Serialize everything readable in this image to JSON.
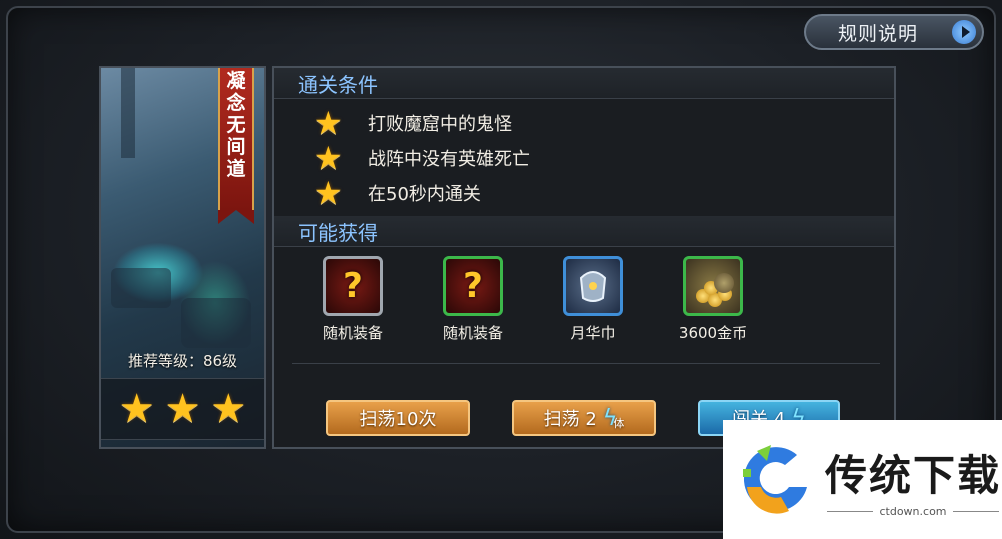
{
  "rules_button": {
    "label": "规则说明",
    "icon": "play-arrow-icon"
  },
  "level": {
    "name_chars": [
      "凝",
      "念",
      "无",
      "间",
      "道"
    ],
    "recommended_level": "推荐等级：86级",
    "stars_earned": 3
  },
  "conditions": {
    "title": "通关条件",
    "items": [
      "打败魔窟中的鬼怪",
      "战阵中没有英雄死亡",
      "在50秒内通关"
    ]
  },
  "rewards": {
    "title": "可能获得",
    "items": [
      {
        "name": "随机装备",
        "icon": "random-equipment-icon"
      },
      {
        "name": "随机装备",
        "icon": "random-equipment-icon"
      },
      {
        "name": "月华巾",
        "icon": "moon-headband-icon"
      },
      {
        "name": "3600金币",
        "icon": "gold-coins-icon"
      }
    ]
  },
  "buttons": {
    "sweep10": "扫荡10次",
    "sweep": "扫荡 2",
    "sweep_stamina": "体",
    "challenge": "闯关 4"
  },
  "watermark": {
    "title": "传统下载",
    "url": "ctdown.com"
  },
  "colors": {
    "accent_blue": "#8cc4ff",
    "star_gold": "#ffc21f",
    "banner_red": "#b22b1f",
    "button_orange": "#d4852e"
  }
}
